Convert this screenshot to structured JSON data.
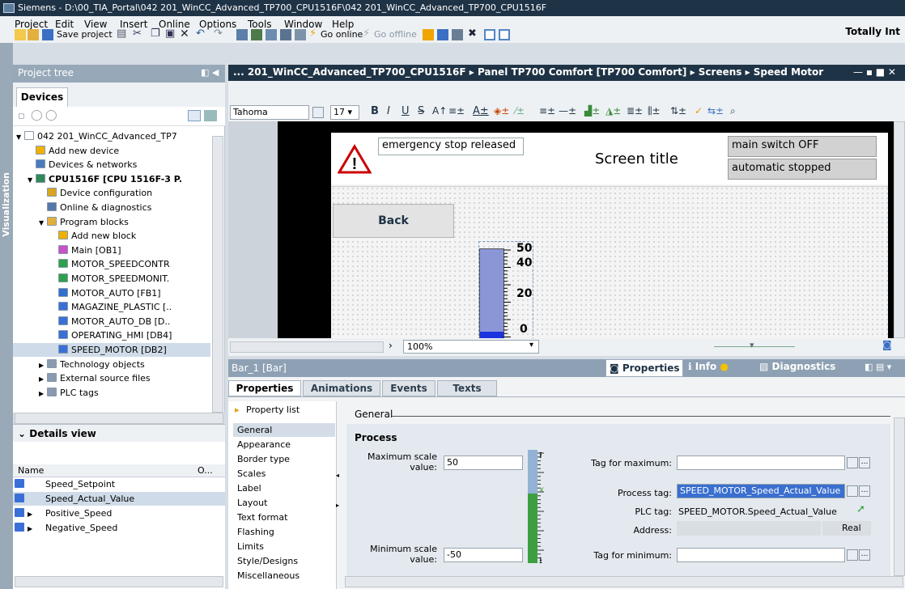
{
  "window": {
    "title": "Siemens - D:\\00_TIA_Portal\\042 201_WinCC_Advanced_TP700_CPU1516F\\042 201_WinCC_Advanced_TP700_CPU1516F"
  },
  "menu": [
    "Project",
    "Edit",
    "View",
    "Insert",
    "Online",
    "Options",
    "Tools",
    "Window",
    "Help"
  ],
  "brand_right": "Totally Int",
  "toolbar": {
    "save_project": "Save project",
    "go_online": "Go online",
    "go_offline": "Go offline"
  },
  "sidebar_strip": "Visualization",
  "project_tree": {
    "header": "Project tree",
    "tab": "Devices",
    "items": [
      {
        "label": "042 201_WinCC_Advanced_TP7",
        "indent": 0,
        "exp": "▼",
        "color": "#ffffff"
      },
      {
        "label": "Add new device",
        "indent": 1,
        "exp": "",
        "color": "#f0b000"
      },
      {
        "label": "Devices & networks",
        "indent": 1,
        "exp": "",
        "color": "#4a7bbf"
      },
      {
        "label": "CPU1516F [CPU 1516F-3 P.",
        "indent": 1,
        "exp": "▼",
        "color": "#2e8b57",
        "bold": true
      },
      {
        "label": "Device configuration",
        "indent": 2,
        "exp": "",
        "color": "#d9a520"
      },
      {
        "label": "Online & diagnostics",
        "indent": 2,
        "exp": "",
        "color": "#5577aa"
      },
      {
        "label": "Program blocks",
        "indent": 2,
        "exp": "▼",
        "color": "#e3b040"
      },
      {
        "label": "Add new block",
        "indent": 3,
        "exp": "",
        "color": "#f0b000"
      },
      {
        "label": "Main [OB1]",
        "indent": 3,
        "exp": "",
        "color": "#c850c8"
      },
      {
        "label": "MOTOR_SPEEDCONTR",
        "indent": 3,
        "exp": "",
        "color": "#2fa04a"
      },
      {
        "label": "MOTOR_SPEEDMONIT.",
        "indent": 3,
        "exp": "",
        "color": "#2fa04a"
      },
      {
        "label": "MOTOR_AUTO [FB1]",
        "indent": 3,
        "exp": "",
        "color": "#2f6fd0"
      },
      {
        "label": "MAGAZINE_PLASTIC [..",
        "indent": 3,
        "exp": "",
        "color": "#3b6fd8"
      },
      {
        "label": "MOTOR_AUTO_DB [D..",
        "indent": 3,
        "exp": "",
        "color": "#3b6fd8"
      },
      {
        "label": "OPERATING_HMI [DB4]",
        "indent": 3,
        "exp": "",
        "color": "#3b6fd8"
      },
      {
        "label": "SPEED_MOTOR [DB2]",
        "indent": 3,
        "exp": "",
        "color": "#3b6fd8",
        "selected": true
      },
      {
        "label": "Technology objects",
        "indent": 2,
        "exp": "▶",
        "color": "#8a9ab0"
      },
      {
        "label": "External source files",
        "indent": 2,
        "exp": "▶",
        "color": "#8a9ab0"
      },
      {
        "label": "PLC tags",
        "indent": 2,
        "exp": "▶",
        "color": "#8a9ab0"
      }
    ]
  },
  "details_view": {
    "header": "Details view",
    "col_name": "Name",
    "col_o": "O...",
    "items": [
      {
        "label": "Speed_Setpoint",
        "exp": ""
      },
      {
        "label": "Speed_Actual_Value",
        "exp": "",
        "selected": true
      },
      {
        "label": "Positive_Speed",
        "exp": "▶"
      },
      {
        "label": "Negative_Speed",
        "exp": "▶"
      }
    ]
  },
  "editor": {
    "breadcrumb": "... 201_WinCC_Advanced_TP700_CPU1516F ▸ Panel TP700 Comfort [TP700 Comfort] ▸ Screens ▸ Speed Motor",
    "font_name": "Tahoma",
    "font_size": "17",
    "zoom": "100%"
  },
  "hmi": {
    "emergency": "emergency stop released",
    "screen_title": "Screen title",
    "main_switch": "main switch OFF",
    "automatic": "automatic stopped",
    "back_button": "Back",
    "bar_ticks": [
      "50",
      "40",
      "20",
      "0"
    ],
    "bar_value_fraction": 0.9
  },
  "properties": {
    "header": "Bar_1 [Bar]",
    "panel_tabs": [
      "Properties",
      "Info",
      "Diagnostics"
    ],
    "tabs": [
      "Properties",
      "Animations",
      "Events",
      "Texts"
    ],
    "property_list": "Property list",
    "side_items": [
      "General",
      "Appearance",
      "Border type",
      "Scales",
      "Label",
      "Layout",
      "Text format",
      "Flashing",
      "Limits",
      "Style/Designs",
      "Miscellaneous"
    ],
    "section": "General",
    "group": "Process",
    "max_label": "Maximum scale value:",
    "max_value": "50",
    "min_label": "Minimum scale value:",
    "min_value": "-50",
    "tag_max_label": "Tag for maximum:",
    "process_tag_label": "Process tag:",
    "process_tag_value": "SPEED_MOTOR_Speed_Actual_Value",
    "plc_tag_label": "PLC tag:",
    "plc_tag_value": "SPEED_MOTOR.Speed_Actual_Value",
    "address_label": "Address:",
    "address_type": "Real",
    "tag_min_label": "Tag for minimum:"
  }
}
